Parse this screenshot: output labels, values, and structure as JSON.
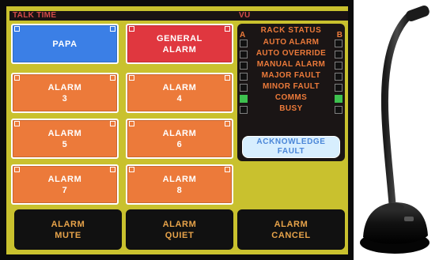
{
  "talk_time": {
    "header": "TALK TIME"
  },
  "vu": {
    "header": "VU"
  },
  "buttons": [
    {
      "label_line1": "PAPA",
      "label_line2": "",
      "color": "#3b7fe6"
    },
    {
      "label_line1": "GENERAL",
      "label_line2": "ALARM",
      "color": "#e0373f"
    },
    {
      "label_line1": "ALARM",
      "label_line2": "3",
      "color": "#ec7a3a"
    },
    {
      "label_line1": "ALARM",
      "label_line2": "4",
      "color": "#ec7a3a"
    },
    {
      "label_line1": "ALARM",
      "label_line2": "5",
      "color": "#ec7a3a"
    },
    {
      "label_line1": "ALARM",
      "label_line2": "6",
      "color": "#ec7a3a"
    },
    {
      "label_line1": "ALARM",
      "label_line2": "7",
      "color": "#ec7a3a"
    },
    {
      "label_line1": "ALARM",
      "label_line2": "8",
      "color": "#ec7a3a"
    }
  ],
  "bottom_buttons": [
    {
      "line1": "ALARM",
      "line2": "MUTE"
    },
    {
      "line1": "ALARM",
      "line2": "QUIET"
    },
    {
      "line1": "ALARM",
      "line2": "CANCEL"
    }
  ],
  "rack_status": {
    "title": "RACK STATUS",
    "col_a": "A",
    "col_b": "B",
    "rows": [
      {
        "label": "AUTO ALARM",
        "a_on": false,
        "b_on": false
      },
      {
        "label": "AUTO OVERRIDE",
        "a_on": false,
        "b_on": false
      },
      {
        "label": "MANUAL ALARM",
        "a_on": false,
        "b_on": false
      },
      {
        "label": "MAJOR FAULT",
        "a_on": false,
        "b_on": false
      },
      {
        "label": "MINOR FAULT",
        "a_on": false,
        "b_on": false
      },
      {
        "label": "COMMS",
        "a_on": true,
        "b_on": true
      },
      {
        "label": "BUSY",
        "a_on": false,
        "b_on": false
      }
    ],
    "ack_line1": "ACKNOWLEDGE",
    "ack_line2": "FAULT"
  },
  "colors": {
    "panel": "#c9c12e",
    "orange": "#ec7a3a",
    "green": "#3ec14f",
    "ack_text": "#4a86d8"
  }
}
